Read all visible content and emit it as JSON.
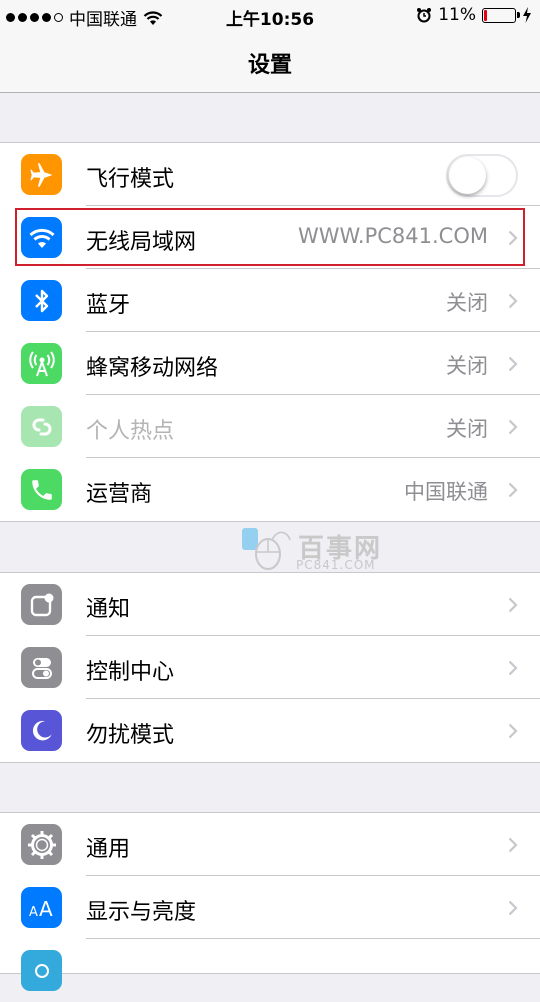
{
  "status_bar": {
    "carrier": "中国联通",
    "time": "上午10:56",
    "battery": "11%",
    "battery_level": 0.11,
    "signal_bars": 4,
    "signal_total": 5
  },
  "nav": {
    "title": "设置"
  },
  "groups": [
    {
      "rows": [
        {
          "label": "飞行模式",
          "icon": "airplane-icon",
          "color": "#ff9500",
          "toggle": false
        },
        {
          "label": "无线局域网",
          "value": "WWW.PC841.COM",
          "icon": "wifi-icon",
          "color": "#007aff"
        },
        {
          "label": "蓝牙",
          "value": "关闭",
          "icon": "bluetooth-icon",
          "color": "#007aff"
        },
        {
          "label": "蜂窝移动网络",
          "value": "关闭",
          "icon": "cellular-icon",
          "color": "#4cd964"
        },
        {
          "label": "个人热点",
          "value": "关闭",
          "icon": "hotspot-icon",
          "color": "#a8e6b1",
          "disabled": true
        },
        {
          "label": "运营商",
          "value": "中国联通",
          "icon": "phone-icon",
          "color": "#4cd964"
        }
      ]
    },
    {
      "rows": [
        {
          "label": "通知",
          "icon": "notifications-icon",
          "color": "#8e8e93"
        },
        {
          "label": "控制中心",
          "icon": "control-center-icon",
          "color": "#8e8e93"
        },
        {
          "label": "勿扰模式",
          "icon": "moon-icon",
          "color": "#5856d6"
        }
      ]
    },
    {
      "rows": [
        {
          "label": "通用",
          "icon": "gear-icon",
          "color": "#8e8e93"
        },
        {
          "label": "显示与亮度",
          "icon": "display-icon",
          "color": "#007aff"
        },
        {
          "label": "",
          "icon": "wallpaper-icon",
          "color": "#34aadc"
        }
      ]
    }
  ],
  "watermark": {
    "title": "百事网",
    "subtitle": "PC841.COM"
  }
}
